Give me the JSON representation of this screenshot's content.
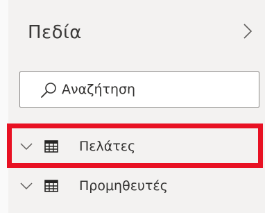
{
  "pane": {
    "title": "Πεδία",
    "expand_icon": "chevron-right-icon"
  },
  "search": {
    "placeholder": "Αναζήτηση",
    "value": "",
    "icon": "search-icon"
  },
  "fields": [
    {
      "label": "Πελάτες",
      "icon": "table-icon",
      "expanded": false,
      "highlighted": true
    },
    {
      "label": "Προμηθευτές",
      "icon": "table-icon",
      "expanded": false,
      "highlighted": false
    }
  ],
  "colors": {
    "background": "#f3f2f1",
    "text": "#323130",
    "highlight": "#e81123"
  }
}
